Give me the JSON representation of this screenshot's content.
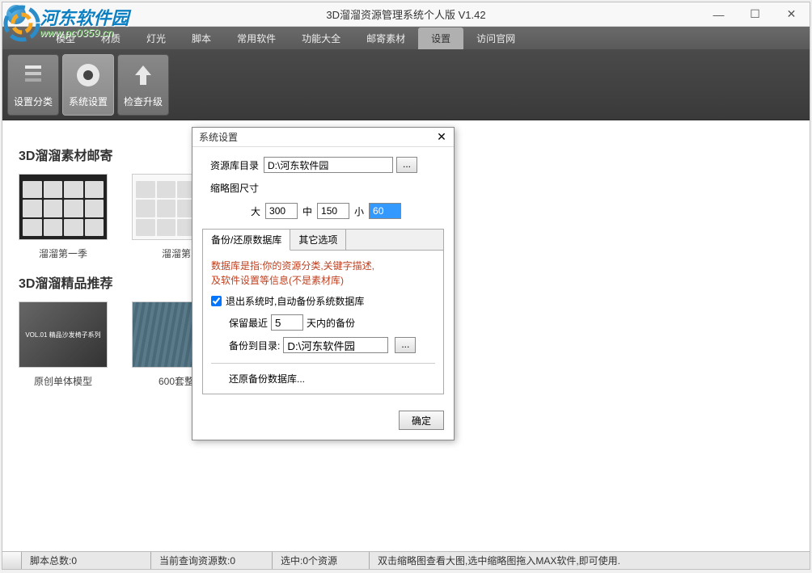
{
  "window": {
    "title": "3D溜溜资源管理系统个人版 V1.42"
  },
  "watermark": {
    "cn": "河东软件园",
    "url": "www.pc0359.cn"
  },
  "menu": {
    "items": [
      "模型",
      "材质",
      "灯光",
      "脚本",
      "常用软件",
      "功能大全",
      "邮寄素材",
      "设置",
      "访问官网"
    ],
    "activeIndex": 7
  },
  "toolbar": {
    "items": [
      {
        "label": "设置分类"
      },
      {
        "label": "系统设置"
      },
      {
        "label": "检查升级"
      }
    ],
    "activeIndex": 1
  },
  "sections": [
    {
      "title": "3D溜溜素材邮寄",
      "thumbs": [
        {
          "label": "溜溜第一季"
        },
        {
          "label": "溜溜第"
        }
      ]
    },
    {
      "title": "3D溜溜精品推荐",
      "thumbs": [
        {
          "label": "原创单体模型",
          "tag": "VOL.01 精品沙发椅子系列"
        },
        {
          "label": "600套整"
        }
      ]
    }
  ],
  "status": {
    "scripts": "脚本总数:0",
    "query": "当前查询资源数:0",
    "selected": "选中:0个资源",
    "hint": "双击缩略图查看大图,选中缩略图拖入MAX软件,即可使用."
  },
  "dialog": {
    "title": "系统设置",
    "resLabel": "资源库目录",
    "resPath": "D:\\河东软件园",
    "thumbLabel": "缩略图尺寸",
    "sizes": {
      "bigLabel": "大",
      "big": "300",
      "midLabel": "中",
      "mid": "150",
      "smallLabel": "小",
      "small": "60"
    },
    "tabs": {
      "backup": "备份/还原数据库",
      "other": "其它选项"
    },
    "dbNote1": "数据库是指:你的资源分类,关键字描述,",
    "dbNote2": "及软件设置等信息(不是素材库)",
    "autoBackup": "退出系统时,自动备份系统数据库",
    "keepLabel1": "保留最近",
    "keepDays": "5",
    "keepLabel2": "天内的备份",
    "backupDirLabel": "备份到目录:",
    "backupDir": "D:\\河东软件园",
    "restoreLabel": "还原备份数据库...",
    "ok": "确定",
    "browse": "..."
  }
}
